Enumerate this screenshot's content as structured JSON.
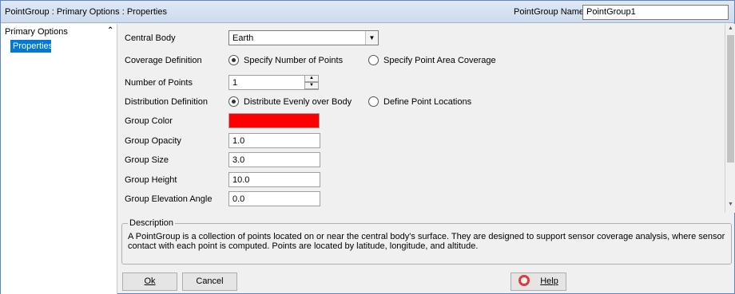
{
  "titlebar": {
    "title": "PointGroup : Primary Options : Properties",
    "name_label": "PointGroup Name",
    "name_value": "PointGroup1"
  },
  "sidebar": {
    "group_label": "Primary Options",
    "items": [
      {
        "label": "Properties"
      }
    ]
  },
  "form": {
    "central_body": {
      "label": "Central Body",
      "value": "Earth"
    },
    "coverage_definition": {
      "label": "Coverage Definition",
      "options": [
        {
          "label": "Specify Number of Points",
          "selected": true
        },
        {
          "label": "Specify Point Area Coverage",
          "selected": false
        }
      ]
    },
    "number_of_points": {
      "label": "Number of Points",
      "value": "1"
    },
    "distribution_definition": {
      "label": "Distribution Definition",
      "options": [
        {
          "label": "Distribute Evenly over Body",
          "selected": true
        },
        {
          "label": "Define Point Locations",
          "selected": false
        }
      ]
    },
    "group_color": {
      "label": "Group Color",
      "color": "#ff0000"
    },
    "group_opacity": {
      "label": "Group Opacity",
      "value": "1.0"
    },
    "group_size": {
      "label": "Group Size",
      "value": "3.0"
    },
    "group_height": {
      "label": "Group Height",
      "value": "10.0"
    },
    "group_elevation_angle": {
      "label": "Group Elevation Angle",
      "value": "0.0"
    }
  },
  "description": {
    "legend": "Description",
    "text": "A PointGroup is a collection of points located on or near the central body's surface. They are designed to support sensor coverage analysis, where sensor contact with each point is computed. Points are located by latitude, longitude, and altitude."
  },
  "buttons": {
    "ok_label": "Ok",
    "cancel_label": "Cancel",
    "help_label": "Help"
  }
}
